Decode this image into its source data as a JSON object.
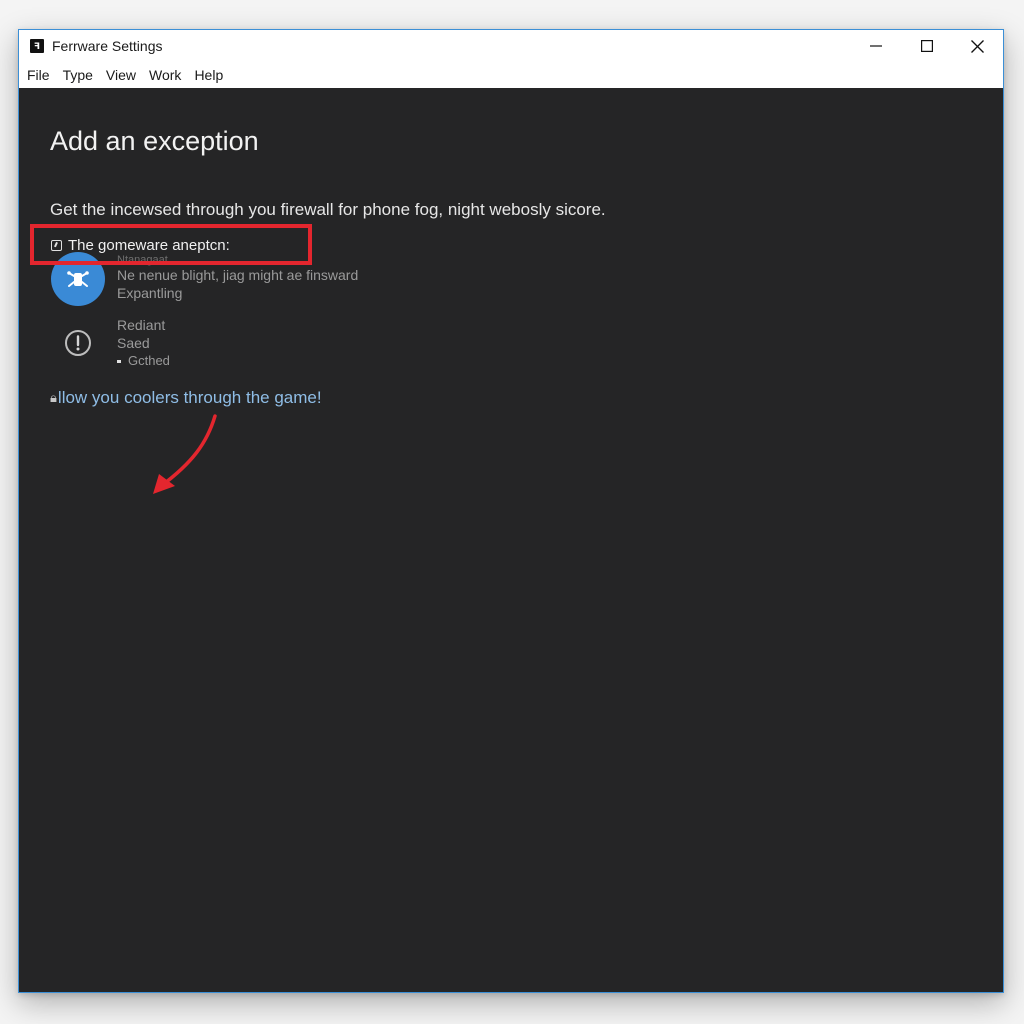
{
  "window": {
    "title": "Ferrware Settings",
    "app_icon": "app-icon",
    "controls": {
      "minimize": "minimize-icon",
      "maximize": "maximize-icon",
      "close": "close-icon"
    }
  },
  "menubar": {
    "items": [
      {
        "label": "File"
      },
      {
        "label": "Type"
      },
      {
        "label": "View"
      },
      {
        "label": "Work"
      },
      {
        "label": "Help"
      }
    ]
  },
  "content": {
    "title": "Add an exception",
    "description": "Get the incewsed through you firewall for phone fog, night webosly sicore.",
    "exception_label": "The gomeware aneptcn:",
    "items": [
      {
        "icon": "app-avatar-icon",
        "faint_label": "Ntanagaat",
        "line1": "Ne nenue blight, jiag mіght ae finsward",
        "line2": "Expantling"
      },
      {
        "icon": "alert-circle-icon",
        "line1": "Rediant",
        "line2": "Saed",
        "line3": "Gcthed"
      }
    ],
    "allow_link": "llow you coolers through the game!",
    "allow_link_icon": "lock-icon"
  },
  "annotations": {
    "highlight_color": "#e3262e",
    "arrow_color": "#e3262e"
  },
  "colors": {
    "content_bg": "#252526",
    "titlebar_bg": "#ffffff",
    "window_border": "#3b8fd6",
    "link": "#8fbde6",
    "avatar": "#3a8ad6"
  }
}
